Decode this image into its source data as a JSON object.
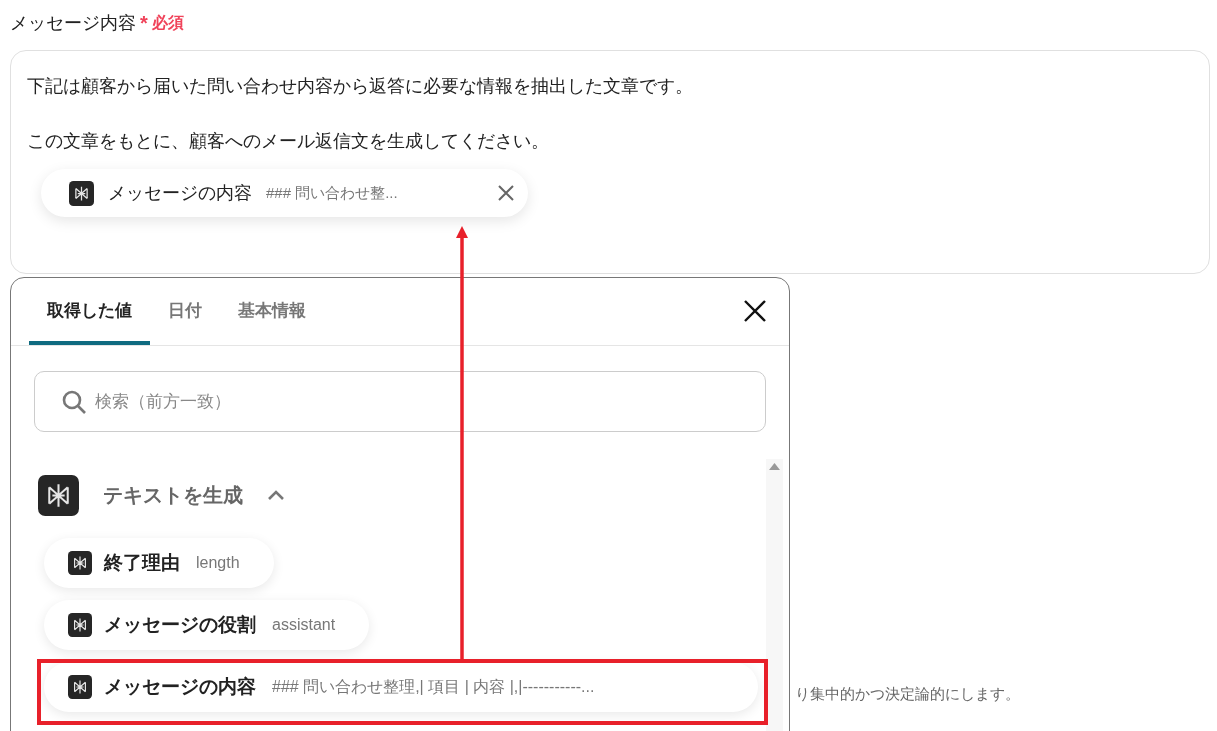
{
  "field": {
    "label": "メッセージ内容",
    "required_mark": "*",
    "required_label": "必須",
    "paragraphs": [
      "下記は顧客から届いた問い合わせ内容から返答に必要な情報を抽出した文章です。",
      "この文章をもとに、顧客へのメール返信文を生成してください。"
    ],
    "token": {
      "name": "メッセージの内容",
      "preview": "### 問い合わせ整..."
    }
  },
  "popup": {
    "tabs": [
      {
        "label": "取得した値",
        "selected": true
      },
      {
        "label": "日付",
        "selected": false
      },
      {
        "label": "基本情報",
        "selected": false
      }
    ],
    "search": {
      "placeholder": "検索（前方一致）"
    },
    "group": {
      "title": "テキストを生成",
      "expanded": true,
      "items": [
        {
          "name": "終了理由",
          "value": "length",
          "highlighted": false
        },
        {
          "name": "メッセージの役割",
          "value": "assistant",
          "highlighted": false
        },
        {
          "name": "メッセージの内容",
          "value": "### 問い合わせ整理,| 項目 | 内容 |,|-----------...",
          "highlighted": true
        }
      ]
    }
  },
  "hint": "り集中的かつ決定論的にします。"
}
